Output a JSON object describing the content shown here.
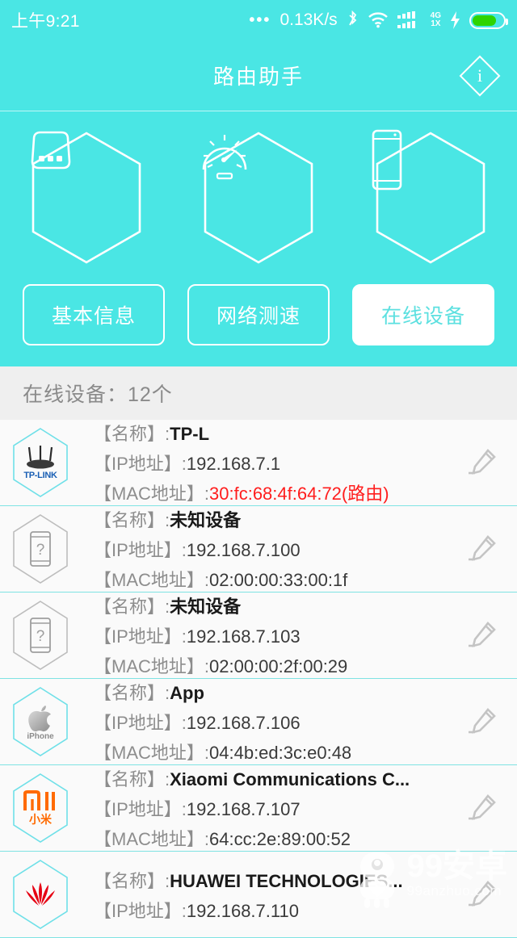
{
  "statusbar": {
    "time": "上午9:21",
    "dots": "•••",
    "network_speed": "0.13K/s",
    "bluetooth_icon": "bluetooth-icon",
    "wifi_icon": "wifi-icon",
    "signal_icon": "signal-bars-icon",
    "network_type_top": "4G",
    "network_type_bottom": "1X",
    "charging_icon": "charging-bolt-icon",
    "battery_icon": "battery-icon"
  },
  "header": {
    "title": "路由助手",
    "info_label": "i"
  },
  "features": [
    {
      "name": "router-hex-icon",
      "icon": "router-icon"
    },
    {
      "name": "speedtest-hex-icon",
      "icon": "speedometer-icon"
    },
    {
      "name": "devices-hex-icon",
      "icon": "smartphone-icon"
    }
  ],
  "tabs": [
    {
      "label": "基本信息",
      "active": false
    },
    {
      "label": "网络测速",
      "active": false
    },
    {
      "label": "在线设备",
      "active": true
    }
  ],
  "section": {
    "title": "在线设备：12个",
    "device_count": 12
  },
  "labels": {
    "name": "【名称】:",
    "ip": "【IP地址】:",
    "mac": "【MAC地址】:"
  },
  "devices": [
    {
      "brand": "tp-link",
      "name": "TP-L",
      "ip": "192.168.7.1",
      "mac": "30:fc:68:4f:64:72(路由)",
      "is_router": true,
      "logo_text": "TP-LINK"
    },
    {
      "brand": "unknown",
      "name": "未知设备",
      "ip": "192.168.7.100",
      "mac": "02:00:00:33:00:1f",
      "is_router": false,
      "logo_text": "?"
    },
    {
      "brand": "unknown",
      "name": "未知设备",
      "ip": "192.168.7.103",
      "mac": "02:00:00:2f:00:29",
      "is_router": false,
      "logo_text": "?"
    },
    {
      "brand": "apple",
      "name": "App",
      "ip": "192.168.7.106",
      "mac": "04:4b:ed:3c:e0:48",
      "is_router": false,
      "logo_text": "iPhone"
    },
    {
      "brand": "xiaomi",
      "name": "Xiaomi Communications C...",
      "ip": "192.168.7.107",
      "mac": "64:cc:2e:89:00:52",
      "is_router": false,
      "logo_text": "小米"
    },
    {
      "brand": "huawei",
      "name": "HUAWEI TECHNOLOGIES...",
      "ip": "192.168.7.110",
      "mac": "",
      "is_router": false,
      "logo_text": ""
    }
  ],
  "edit_icon": "pencil-edit-icon",
  "watermark": {
    "main": "99安卓",
    "sub": "99anzhuo.com",
    "mascot": "android-robot-icon"
  },
  "colors": {
    "teal": "#4ae6e4",
    "tab_active_text": "#5ce0e0",
    "router_mac_red": "#ff1d1d",
    "section_bg": "#efefef",
    "row_divider": "#7fe3e3",
    "battery_green": "#2ed400"
  }
}
